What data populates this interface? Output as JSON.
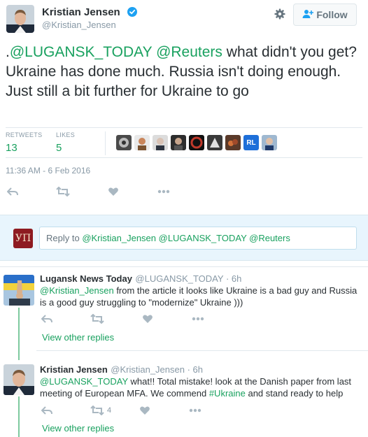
{
  "tweet": {
    "author_name": "Kristian Jensen",
    "author_handle": "@Kristian_Jensen",
    "follow_label": "Follow",
    "text_prefix": ".",
    "mention1": "@LUGANSK_TODAY",
    "mention2": "@Reuters",
    "text_body": " what didn't you get? Ukraine has done much. Russia isn't doing enough. Just still a bit further for Ukraine to go",
    "retweets_label": "RETWEETS",
    "retweets_count": "13",
    "likes_label": "LIKES",
    "likes_count": "5",
    "timestamp": "11:36 AM - 6 Feb 2016",
    "liker_avatar_badge": "RL"
  },
  "reply_composer": {
    "avatar_text": "УП",
    "prefix": "Reply to ",
    "mentions": "@Kristian_Jensen @LUGANSK_TODAY @Reuters"
  },
  "replies": [
    {
      "name": "Lugansk News Today",
      "handle": "@LUGANSK_TODAY",
      "time": "6h",
      "mention": "@Kristian_Jensen",
      "text": " from the article it looks like Ukraine is a bad guy and Russia is a good guy struggling to \"modernize\" Ukraine )))",
      "view_replies": "View other replies"
    },
    {
      "name": "Kristian Jensen",
      "handle": "@Kristian_Jensen",
      "time": "6h",
      "mention": "@LUGANSK_TODAY",
      "text_a": " what!! Total mistake! look at the Danish paper from last meeting of European MFA. We commend ",
      "hashtag": "#Ukraine",
      "text_b": " and stand ready to help",
      "retweet_count": "4",
      "view_replies": "View other replies"
    }
  ],
  "colors": {
    "accent": "#19a15f",
    "muted": "#8899a6",
    "text": "#292f33",
    "verified": "#1da1f2",
    "composer_bg": "#e8f5fd"
  },
  "icons": [
    "verified-icon",
    "gear-icon",
    "follow-person-icon",
    "reply-icon",
    "retweet-icon",
    "like-icon",
    "more-icon"
  ]
}
